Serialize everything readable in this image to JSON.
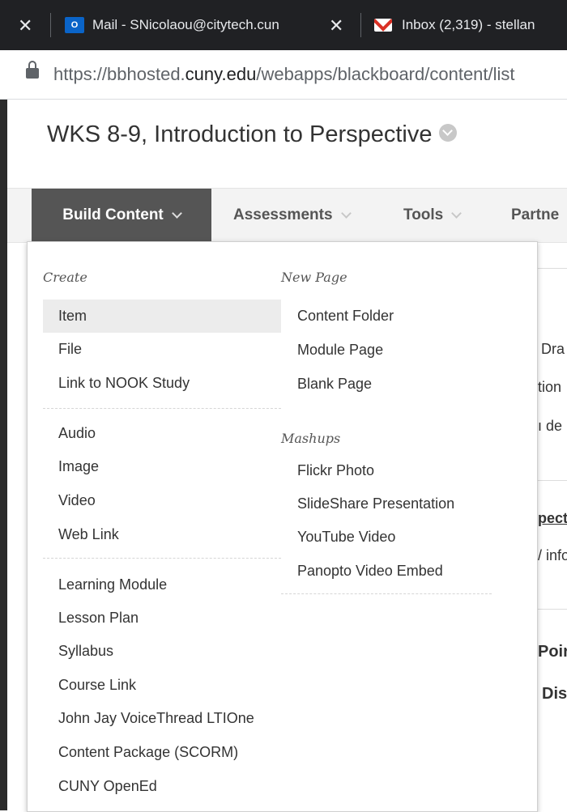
{
  "browser": {
    "tabs": [
      {
        "title": "Mail - SNicolaou@citytech.cun"
      },
      {
        "title": "Inbox (2,319) - stellan"
      }
    ],
    "close_glyph": "✕",
    "outlook_glyph": "O",
    "url_prefix": "https://bbhosted.",
    "url_domain": "cuny.edu",
    "url_path": "/webapps/blackboard/content/list"
  },
  "course": {
    "title": "WKS 8-9, Introduction to Perspective"
  },
  "nav": {
    "items": [
      {
        "label": "Build Content"
      },
      {
        "label": "Assessments"
      },
      {
        "label": "Tools"
      },
      {
        "label": "Partne"
      }
    ]
  },
  "background_text": [
    "Dra",
    "tion",
    "ı de",
    "pect",
    "/ info",
    "Poir",
    "Dis"
  ],
  "menu": {
    "create_heading": "Create",
    "create_group1": [
      {
        "label": "Item"
      },
      {
        "label": "File"
      },
      {
        "label": "Link to NOOK Study"
      }
    ],
    "create_group2": [
      {
        "label": "Audio"
      },
      {
        "label": "Image"
      },
      {
        "label": "Video"
      },
      {
        "label": "Web Link"
      }
    ],
    "create_group3": [
      {
        "label": "Learning Module"
      },
      {
        "label": "Lesson Plan"
      },
      {
        "label": "Syllabus"
      },
      {
        "label": "Course Link"
      },
      {
        "label": "John Jay VoiceThread LTIOne"
      },
      {
        "label": "Content Package (SCORM)"
      },
      {
        "label": "CUNY OpenEd"
      }
    ],
    "newpage_heading": "New Page",
    "newpage_items": [
      {
        "label": "Content Folder"
      },
      {
        "label": "Module Page"
      },
      {
        "label": "Blank Page"
      }
    ],
    "mashups_heading": "Mashups",
    "mashups_items": [
      {
        "label": "Flickr Photo"
      },
      {
        "label": "SlideShare Presentation"
      },
      {
        "label": "YouTube Video"
      },
      {
        "label": "Panopto Video Embed"
      }
    ]
  },
  "colors": {
    "tabstrip": "#202124",
    "active_nav": "#555555",
    "menu_highlight": "#ececec"
  },
  "icons": [
    "close-icon",
    "outlook-icon",
    "gmail-icon",
    "lock-icon",
    "chevron-down-icon"
  ]
}
